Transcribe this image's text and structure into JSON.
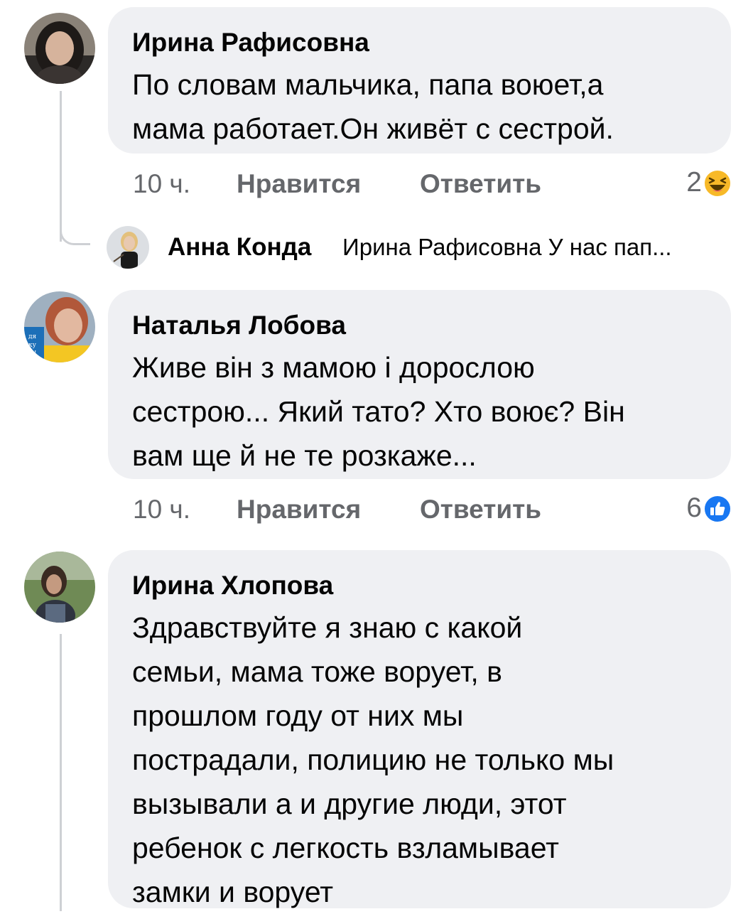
{
  "comments": [
    {
      "author": "Ирина Рафисовна",
      "lines": [
        "По словам мальчика, папа воюет,а",
        "мама работает.Он живёт с сестрой."
      ],
      "time": "10 ч.",
      "like_label": "Нравится",
      "reply_label": "Ответить",
      "reaction_count": "2",
      "reaction_icon": "haha-emoji-icon"
    },
    {
      "author": "Наталья Лобова",
      "lines": [
        "Живе він з мамою і дорослою",
        "сестрою... Який тато? Хто воює? Він",
        "вам ще й не те розкаже..."
      ],
      "time": "10 ч.",
      "like_label": "Нравится",
      "reply_label": "Ответить",
      "reaction_count": "6",
      "reaction_icon": "like-thumb-icon"
    },
    {
      "author": "Ирина Хлопова",
      "lines": [
        "Здравствуйте я знаю с какой",
        "семьи, мама тоже ворует, в",
        "прошлом году от них мы",
        "пострадали, полицию не только мы",
        "вызывали а и другие люди, этот",
        "ребенок с легкость взламывает",
        "замки и ворует"
      ]
    }
  ],
  "reply": {
    "author": "Анна Конда",
    "preview": "Ирина Рафисовна У нас пап..."
  },
  "colors": {
    "bubble_bg": "#eff0f3",
    "secondary_text": "#65676b",
    "like_blue": "#1877f2",
    "haha_yellow": "#f7b928",
    "thread_line": "#ced0d4"
  }
}
